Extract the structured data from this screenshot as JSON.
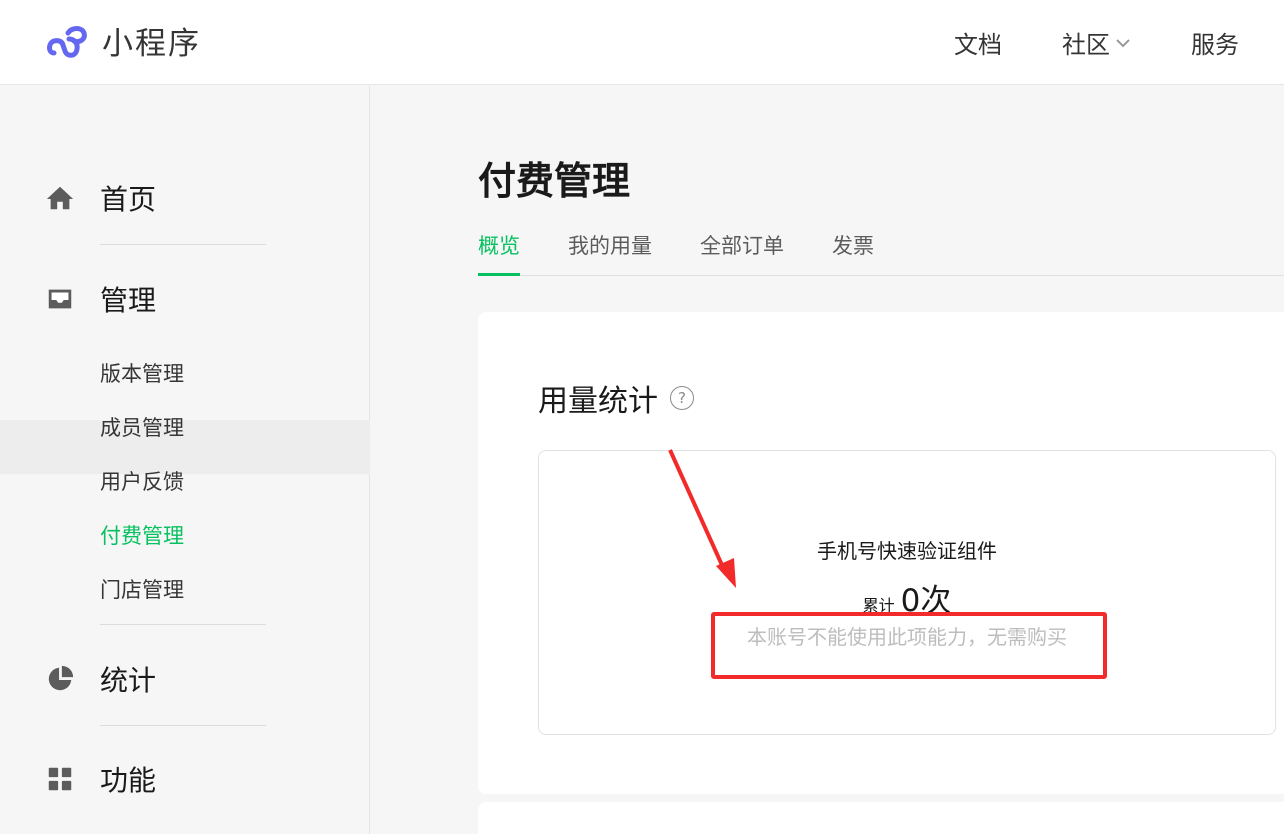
{
  "header": {
    "logo_text": "小程序",
    "nav": {
      "docs": "文档",
      "community": "社区",
      "service": "服务"
    },
    "brand_color": "#6467f0"
  },
  "sidebar": {
    "home": "首页",
    "manage": "管理",
    "manage_items": [
      "版本管理",
      "成员管理",
      "用户反馈",
      "付费管理",
      "门店管理"
    ],
    "active_item": "付费管理",
    "stats": "统计",
    "features": "功能",
    "accent_color": "#07c160"
  },
  "main": {
    "title": "付费管理",
    "tabs": [
      "概览",
      "我的用量",
      "全部订单",
      "发票"
    ],
    "active_tab": "概览",
    "section_title": "用量统计",
    "card": {
      "name": "手机号快速验证组件",
      "total_label": "累计",
      "total_value": "0次",
      "note": "本账号不能使用此项能力，无需购买"
    }
  },
  "annotation": {
    "highlight_color": "#f22a2a"
  }
}
